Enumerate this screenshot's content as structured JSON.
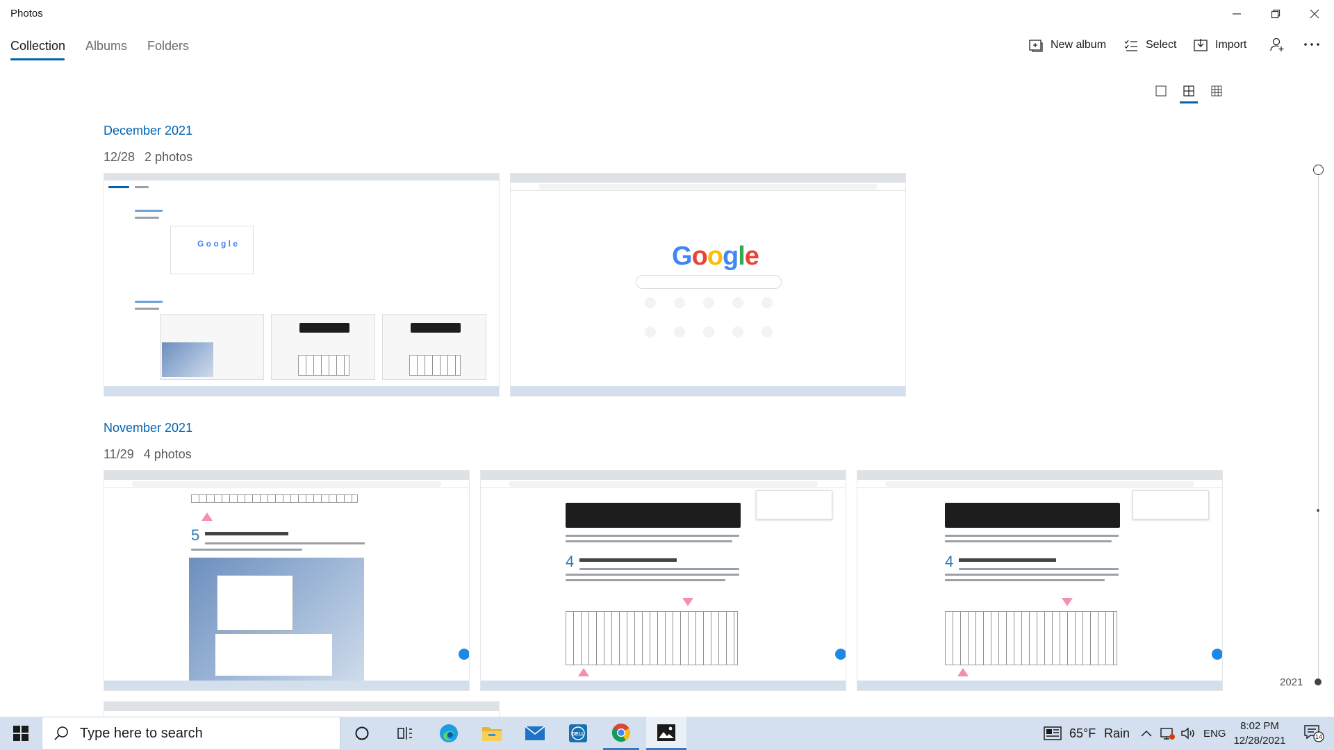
{
  "window": {
    "title": "Photos",
    "minimize": "minimize",
    "maximize": "restore",
    "close": "close"
  },
  "nav": {
    "tabs": [
      {
        "label": "Collection",
        "active": true
      },
      {
        "label": "Albums",
        "active": false
      },
      {
        "label": "Folders",
        "active": false
      }
    ]
  },
  "toolbar": {
    "new_album": "New album",
    "select": "Select",
    "import": "Import",
    "people_icon": "person-add-icon",
    "more_icon": "more-icon"
  },
  "view_options": [
    "large-tiles-icon",
    "medium-tiles-icon",
    "small-tiles-icon"
  ],
  "sections": [
    {
      "month": "December 2021",
      "date": "12/28",
      "count": "2 photos"
    },
    {
      "month": "November 2021",
      "date": "11/29",
      "count": "4 photos"
    }
  ],
  "timeline": {
    "year": "2021"
  },
  "taskbar": {
    "search_placeholder": "Type here to search",
    "weather_temp": "65°F",
    "weather_desc": "Rain",
    "language": "ENG",
    "time": "8:02 PM",
    "date": "12/28/2021",
    "notification_count": "14"
  },
  "colors": {
    "accent": "#0063b1",
    "taskbar": "#d4e0ef"
  }
}
